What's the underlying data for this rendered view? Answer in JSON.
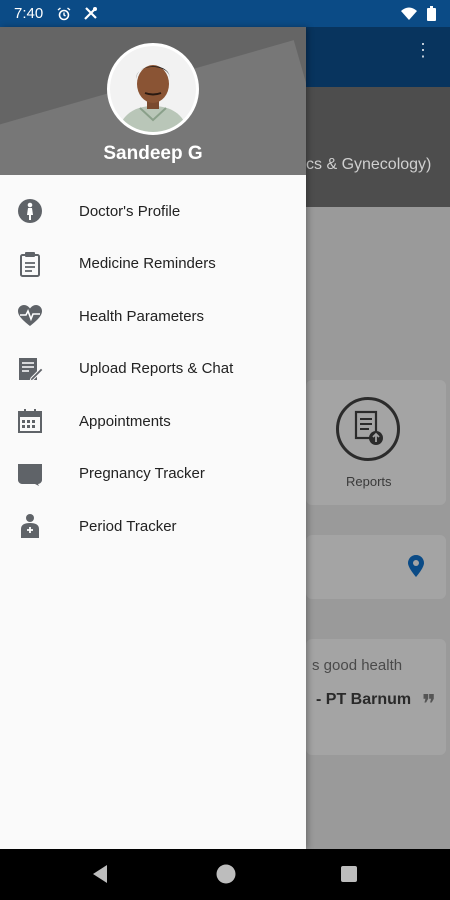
{
  "status_bar": {
    "time": "7:40",
    "left_icons": [
      "alarm-icon",
      "tools-icon"
    ],
    "right_icons": [
      "wifi-icon",
      "battery-icon"
    ]
  },
  "background": {
    "specialty_text": "cs & Gynecology)",
    "reports_label": "Reports",
    "quote_text": "s good health",
    "quote_author": "- PT Barnum"
  },
  "drawer": {
    "user_name": "Sandeep G",
    "items": [
      {
        "label": "Doctor's Profile",
        "icon": "doctor-icon"
      },
      {
        "label": "Medicine Reminders",
        "icon": "clipboard-icon"
      },
      {
        "label": "Health Parameters",
        "icon": "heart-pulse-icon"
      },
      {
        "label": "Upload Reports & Chat",
        "icon": "upload-report-icon"
      },
      {
        "label": "Appointments",
        "icon": "calendar-icon"
      },
      {
        "label": "Pregnancy Tracker",
        "icon": "pregnancy-icon"
      },
      {
        "label": "Period Tracker",
        "icon": "period-icon"
      }
    ]
  },
  "nav_bar": {
    "buttons": [
      "back-icon",
      "home-icon",
      "recents-icon"
    ]
  },
  "colors": {
    "status_bar": "#0b4b86",
    "icon_grey": "#5f6368",
    "pin_blue": "#0b4b86"
  }
}
